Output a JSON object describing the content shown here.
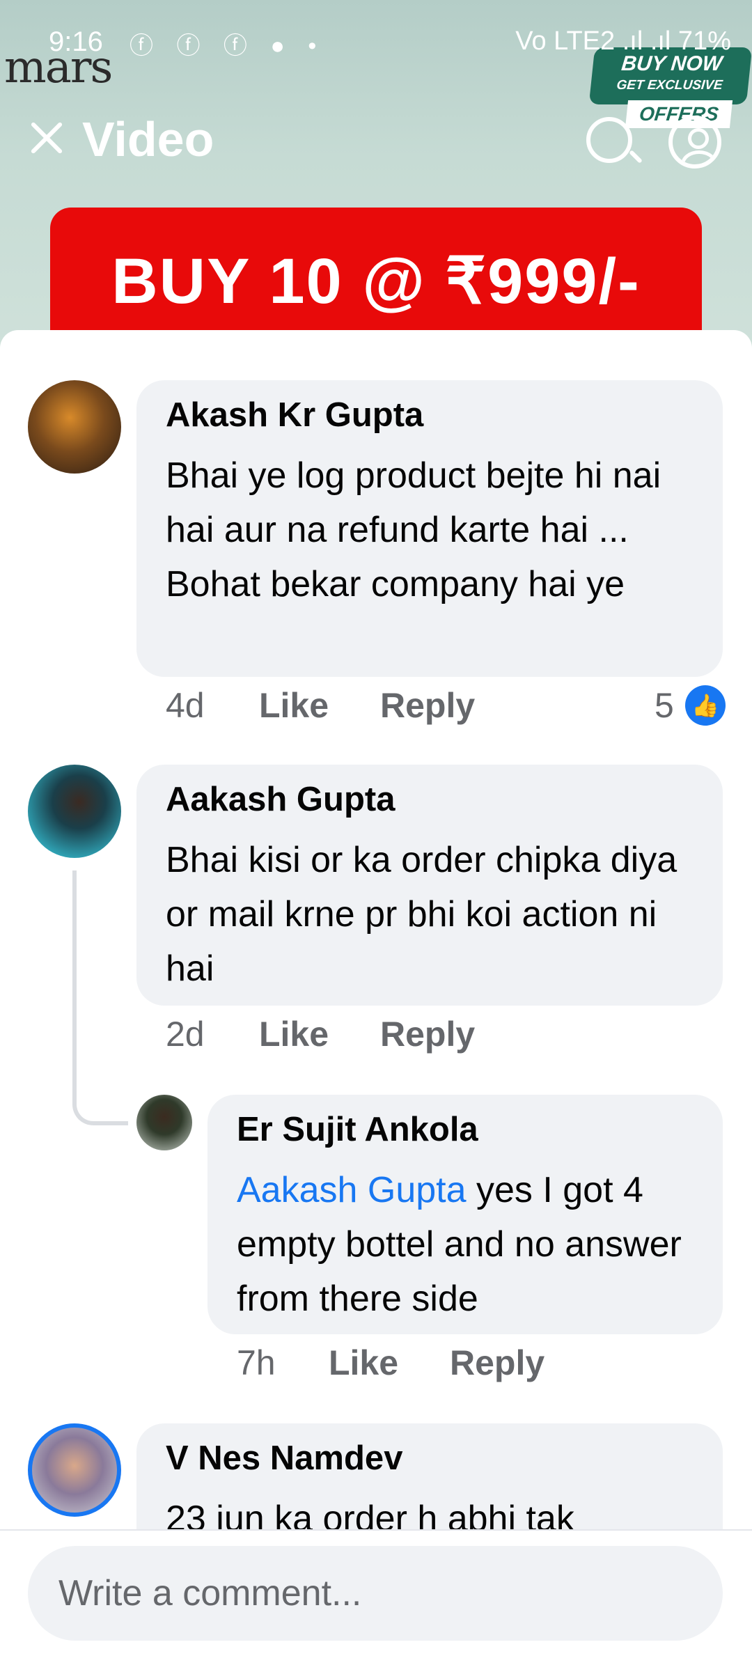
{
  "status_bar": {
    "time": "9:16",
    "notification_icons": "ⓕ ⓕ ⓕ ● •",
    "right": "Vo LTE2 .ıl .ıl 71%"
  },
  "ad": {
    "brand": "mars",
    "buy_now": "BUY NOW",
    "get_exclusive": "GET EXCLUSIVE",
    "offers": "OFFERS",
    "promo": "BUY 10 @  ₹999/-"
  },
  "header": {
    "title": "Video"
  },
  "comments": [
    {
      "author": "Akash Kr Gupta",
      "text": "Bhai ye log product bejte hi nai hai aur na refund karte hai ... Bohat bekar company hai ye",
      "time": "4d",
      "like_label": "Like",
      "reply_label": "Reply",
      "reaction_count": "5"
    },
    {
      "author": "Aakash Gupta",
      "text": "Bhai kisi or ka order chipka diya or mail krne pr bhi koi action ni hai",
      "time": "2d",
      "like_label": "Like",
      "reply_label": "Reply"
    },
    {
      "author": "Er Sujit Ankola",
      "mention": "Aakash Gupta",
      "text": " yes I got 4 empty bottel and no answer from there side",
      "time": "7h",
      "like_label": "Like",
      "reply_label": "Reply"
    },
    {
      "author": "V Nes Namdev",
      "text": "23 jun ka order h abhi tak"
    }
  ],
  "composer": {
    "placeholder": "Write a comment..."
  }
}
